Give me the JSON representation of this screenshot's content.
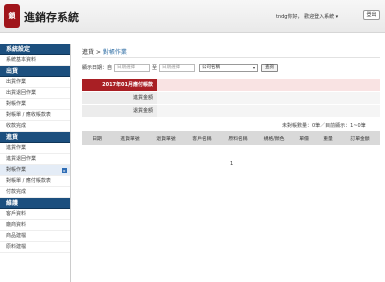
{
  "app": {
    "logo_text": "鎖",
    "title": "進銷存系統",
    "user_text": "tndg你好， 歡迎登入系統 ▾",
    "logout_label": "登出"
  },
  "sidebar": {
    "sections": [
      {
        "title": "系統設定",
        "items": [
          {
            "label": "系統基本資料",
            "active": false
          }
        ]
      },
      {
        "title": "出貨",
        "items": [
          {
            "label": "出貨作業",
            "active": false
          },
          {
            "label": "出貨退回作業",
            "active": false
          },
          {
            "label": "對帳作業",
            "active": false
          },
          {
            "label": "對帳單 / 應收帳款表",
            "active": false
          },
          {
            "label": "收款完成",
            "active": false
          }
        ]
      },
      {
        "title": "進貨",
        "items": [
          {
            "label": "進貨作業",
            "active": false
          },
          {
            "label": "進貨退回作業",
            "active": false
          },
          {
            "label": "對帳作業",
            "active": true
          },
          {
            "label": "對帳單 / 應付帳款表",
            "active": false
          },
          {
            "label": "付款完成",
            "active": false
          }
        ]
      },
      {
        "title": "維護",
        "items": [
          {
            "label": "客戶資料",
            "active": false
          },
          {
            "label": "廠商資料",
            "active": false
          },
          {
            "label": "商品建檔",
            "active": false
          },
          {
            "label": "原料建檔",
            "active": false
          }
        ]
      }
    ],
    "active_arrow": "▸"
  },
  "main": {
    "breadcrumb_parent": "進貨",
    "breadcrumb_sep": " > ",
    "breadcrumb_current": "對帳作業",
    "filter": {
      "date_label": "顯示日期：自",
      "from_placeholder": "日期選擇",
      "to_label": "至",
      "to_placeholder": "日期選擇",
      "company_select": "公司名稱",
      "query_label": "查詢"
    },
    "summary": [
      {
        "label": "2017年01月應付帳款",
        "highlight": true
      },
      {
        "label": "進貨金額",
        "highlight": false
      },
      {
        "label": "退貨金額",
        "highlight": false
      }
    ],
    "count_text": "未對帳數量：0筆／目前顯示：1~0筆",
    "columns": [
      "日期",
      "進貨單號",
      "退貨單號",
      "客戶名稱",
      "原料名稱",
      "規格/顏色",
      "單價",
      "重量",
      "訂單金額"
    ],
    "page_number": "1"
  }
}
